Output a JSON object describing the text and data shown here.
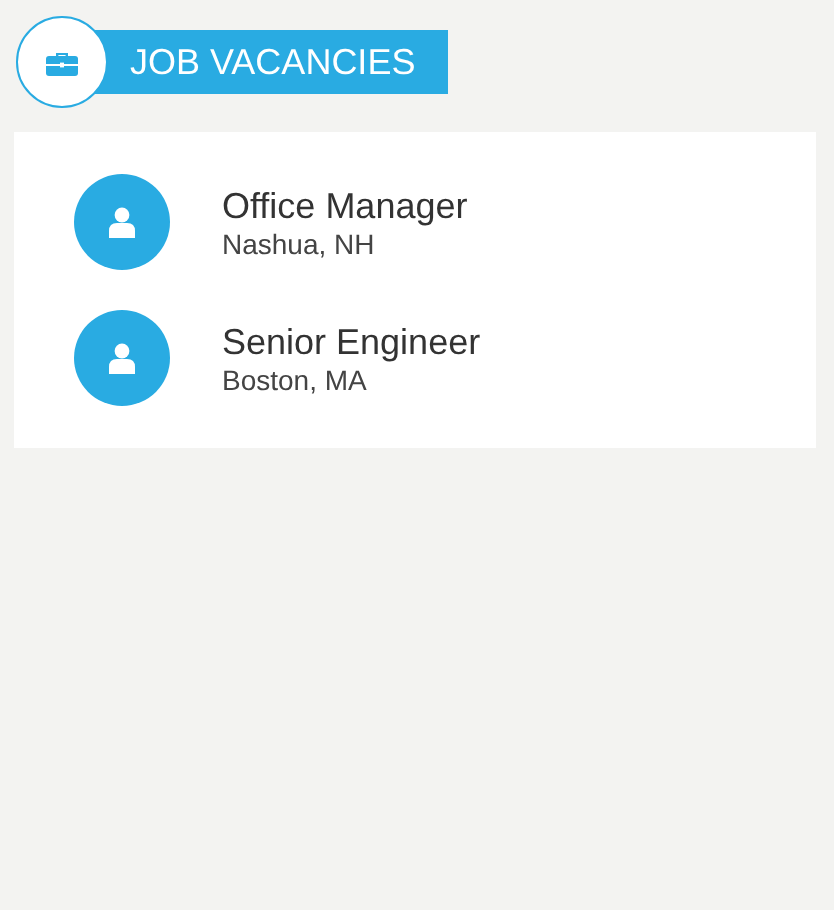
{
  "header": {
    "title": "JOB VACANCIES"
  },
  "jobs": [
    {
      "title": "Office Manager",
      "location": "Nashua, NH"
    },
    {
      "title": "Senior Engineer",
      "location": "Boston, MA"
    }
  ]
}
